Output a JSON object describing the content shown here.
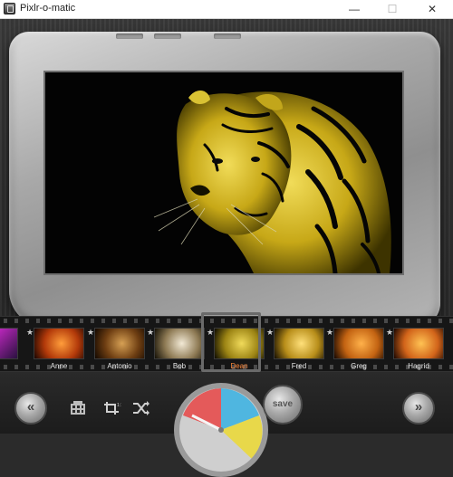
{
  "window": {
    "title": "Pixlr-o-matic",
    "minimize_glyph": "—",
    "maximize_glyph": "☐",
    "close_glyph": "✕"
  },
  "photo": {
    "subject_icon": "tiger-photo"
  },
  "filmstrip": {
    "items": [
      {
        "label": ""
      },
      {
        "label": "Anne"
      },
      {
        "label": "Antonio"
      },
      {
        "label": "Bob"
      },
      {
        "label": "Dean",
        "selected": true
      },
      {
        "label": "Fred"
      },
      {
        "label": "Greg"
      },
      {
        "label": "Hagrid"
      }
    ],
    "star_glyph": "★"
  },
  "toolbar": {
    "prev_glyph": "«",
    "next_glyph": "»",
    "save_label": "save",
    "dial_colors": [
      "#e45a5a",
      "#4fb6e0",
      "#e8d84a"
    ]
  },
  "colors": {
    "selected_label": "#ff8a3d"
  }
}
